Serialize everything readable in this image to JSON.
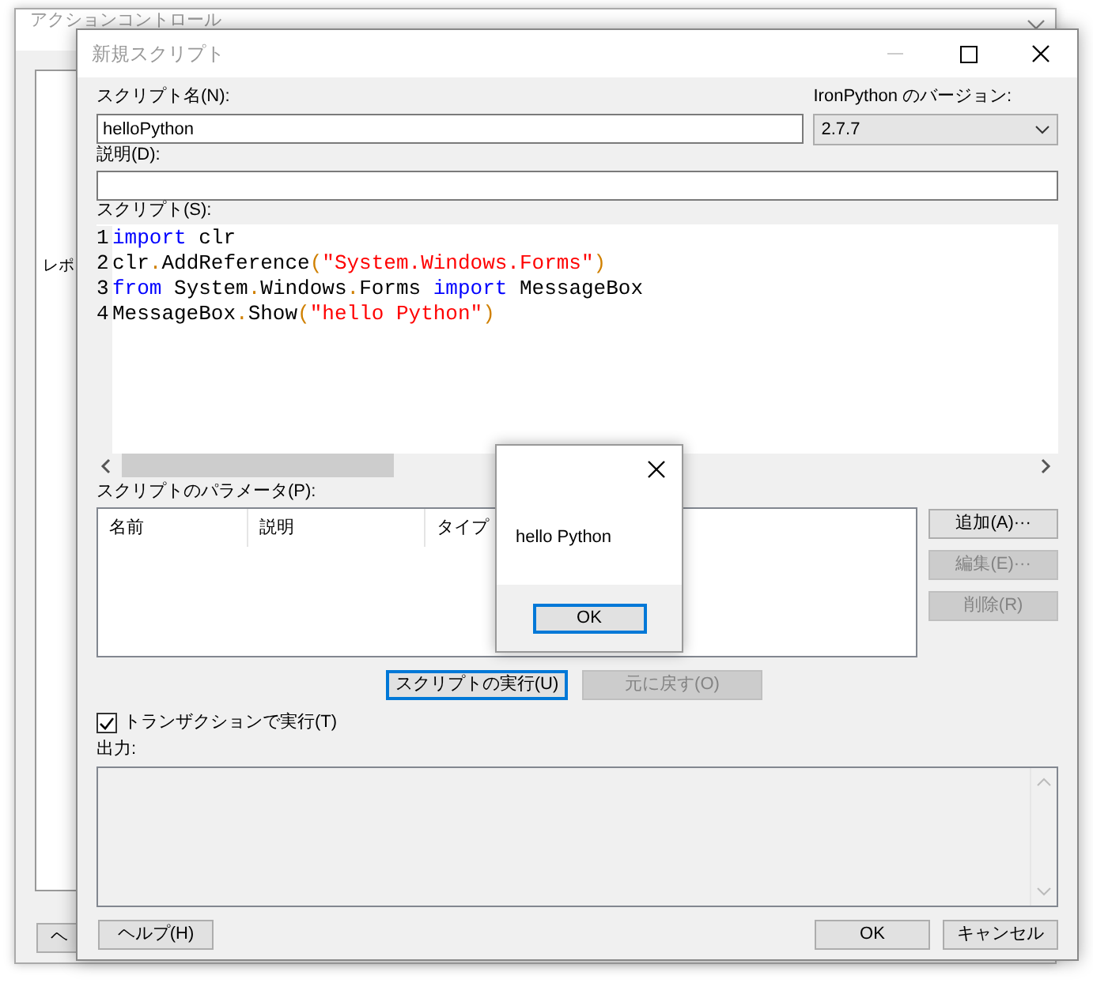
{
  "background_window": {
    "title": "アクションコントロール",
    "label": "レポ",
    "button": "ヘ"
  },
  "dialog": {
    "title": "新規スクリプト",
    "name_label": "スクリプト名(N):",
    "name_value": "helloPython",
    "version_label": "IronPython のバージョン:",
    "version_value": "2.7.7",
    "description_label": "説明(D):",
    "script_label": "スクリプト(S):",
    "code_lines": [
      {
        "number": "1",
        "tokens": [
          {
            "text": "import",
            "kind": "keyword"
          },
          {
            "text": " clr",
            "kind": "plain"
          }
        ]
      },
      {
        "number": "2",
        "tokens": [
          {
            "text": "clr",
            "kind": "plain"
          },
          {
            "text": ".",
            "kind": "operator"
          },
          {
            "text": "AddReference",
            "kind": "plain"
          },
          {
            "text": "(",
            "kind": "operator"
          },
          {
            "text": "\"System.Windows.Forms\"",
            "kind": "string"
          },
          {
            "text": ")",
            "kind": "operator"
          }
        ]
      },
      {
        "number": "3",
        "tokens": [
          {
            "text": "from",
            "kind": "keyword"
          },
          {
            "text": " System",
            "kind": "plain"
          },
          {
            "text": ".",
            "kind": "operator"
          },
          {
            "text": "Windows",
            "kind": "plain"
          },
          {
            "text": ".",
            "kind": "operator"
          },
          {
            "text": "Forms ",
            "kind": "plain"
          },
          {
            "text": "import",
            "kind": "keyword"
          },
          {
            "text": " MessageBox",
            "kind": "plain"
          }
        ]
      },
      {
        "number": "4",
        "tokens": [
          {
            "text": "MessageBox",
            "kind": "plain"
          },
          {
            "text": ".",
            "kind": "operator"
          },
          {
            "text": "Show",
            "kind": "plain"
          },
          {
            "text": "(",
            "kind": "operator"
          },
          {
            "text": "\"hello Python\"",
            "kind": "string"
          },
          {
            "text": ")",
            "kind": "operator"
          }
        ]
      }
    ],
    "parameters_label": "スクリプトのパラメータ(P):",
    "parameter_columns": [
      "名前",
      "説明",
      "タイプ"
    ],
    "side_buttons": [
      {
        "label": "追加(A)···",
        "disabled": false
      },
      {
        "label": "編集(E)···",
        "disabled": true
      },
      {
        "label": "削除(R)",
        "disabled": true
      }
    ],
    "action_buttons": [
      {
        "label": "スクリプトの実行(U)",
        "disabled": false,
        "focused": true
      },
      {
        "label": "元に戻す(O)",
        "disabled": true,
        "focused": false
      }
    ],
    "transaction": {
      "label": "トランザクションで実行(T)",
      "checked": true
    },
    "output_label": "出力:",
    "footer_buttons": [
      {
        "label": "ヘルプ(H)",
        "kind": "left"
      },
      {
        "label": "OK",
        "kind": "right"
      },
      {
        "label": "キャンセル",
        "kind": "right"
      }
    ]
  },
  "message_box": {
    "text": "hello Python",
    "button": "OK"
  }
}
